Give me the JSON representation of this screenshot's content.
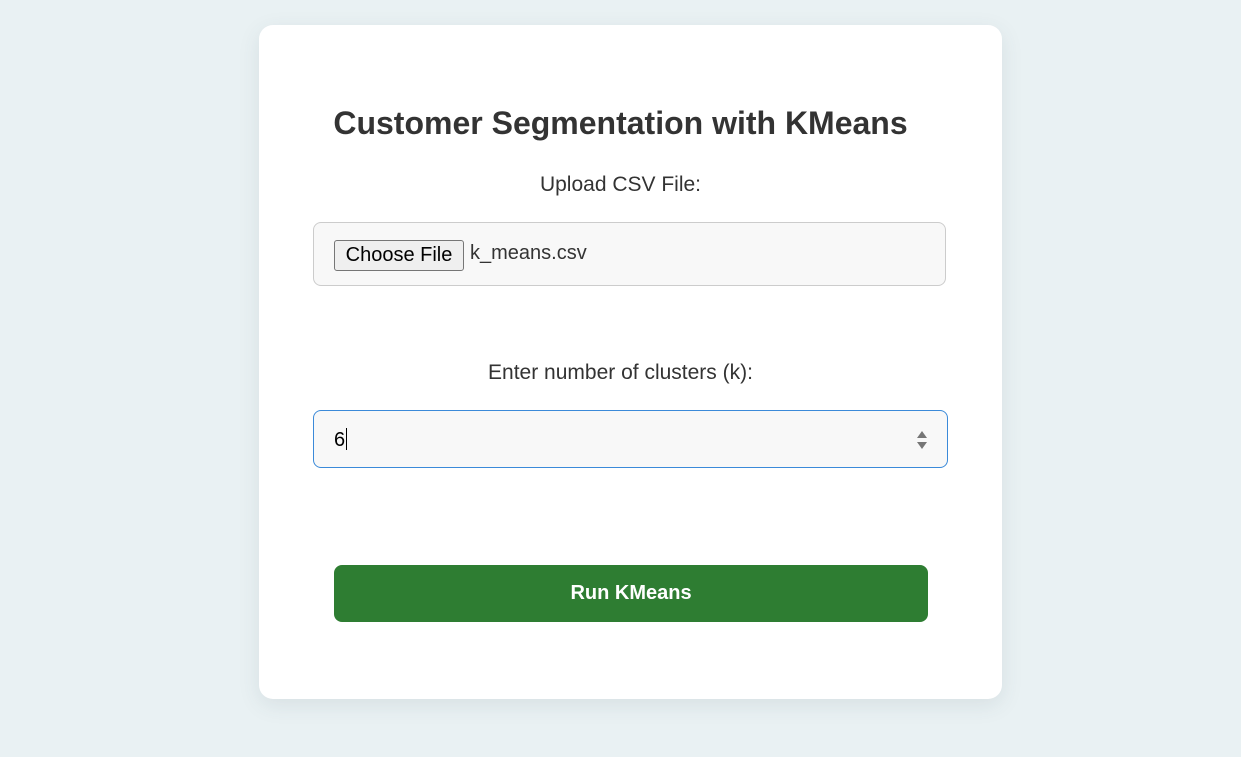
{
  "page": {
    "title": "Customer Segmentation with KMeans",
    "background_color": "#e9f1f3",
    "card_color": "#ffffff"
  },
  "upload": {
    "label": "Upload CSV File:",
    "button_label": "Choose File",
    "file_name": "k_means.csv"
  },
  "clusters": {
    "label": "Enter number of clusters (k):",
    "value": "6",
    "focus_border_color": "#3b8ad9",
    "spinner_icon": "up-down-arrows"
  },
  "submit": {
    "label": "Run KMeans",
    "color": "#2e7d32"
  }
}
